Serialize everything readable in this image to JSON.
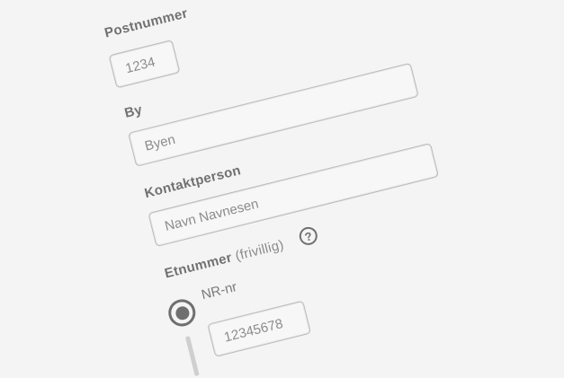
{
  "postal_code": {
    "label": "Postnummer",
    "value": "1234"
  },
  "city": {
    "label": "By",
    "value": "Byen"
  },
  "contact_person": {
    "label": "Kontaktperson",
    "value": "Navn Navnesen"
  },
  "unit_number": {
    "label": "Etnummer",
    "optional_label": "(frivillig)",
    "help_icon": "question-circle-icon",
    "radio_option_label": "NR-nr",
    "radio_selected": true,
    "number_value": "12345678"
  },
  "colors": {
    "background": "#f4f4f4",
    "label": "#717171",
    "input_border": "#b9b9b9",
    "input_text": "#8c8c8c",
    "radio": "#6f6f6f"
  }
}
